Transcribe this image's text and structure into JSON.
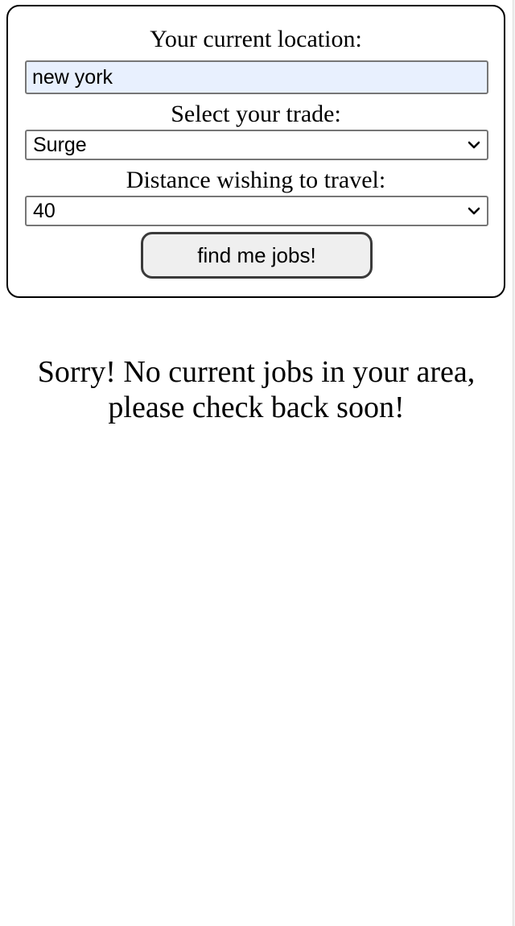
{
  "form": {
    "location_label": "Your current location:",
    "location_value": "new york",
    "trade_label": "Select your trade:",
    "trade_selected": "Surge",
    "distance_label": "Distance wishing to travel:",
    "distance_selected": "40",
    "submit_label": "find me jobs!"
  },
  "result": {
    "message_line1": "Sorry! No current jobs in your area,",
    "message_line2": "please check back soon!"
  },
  "icons": {
    "select_arrow": "chevron-down-icon"
  }
}
